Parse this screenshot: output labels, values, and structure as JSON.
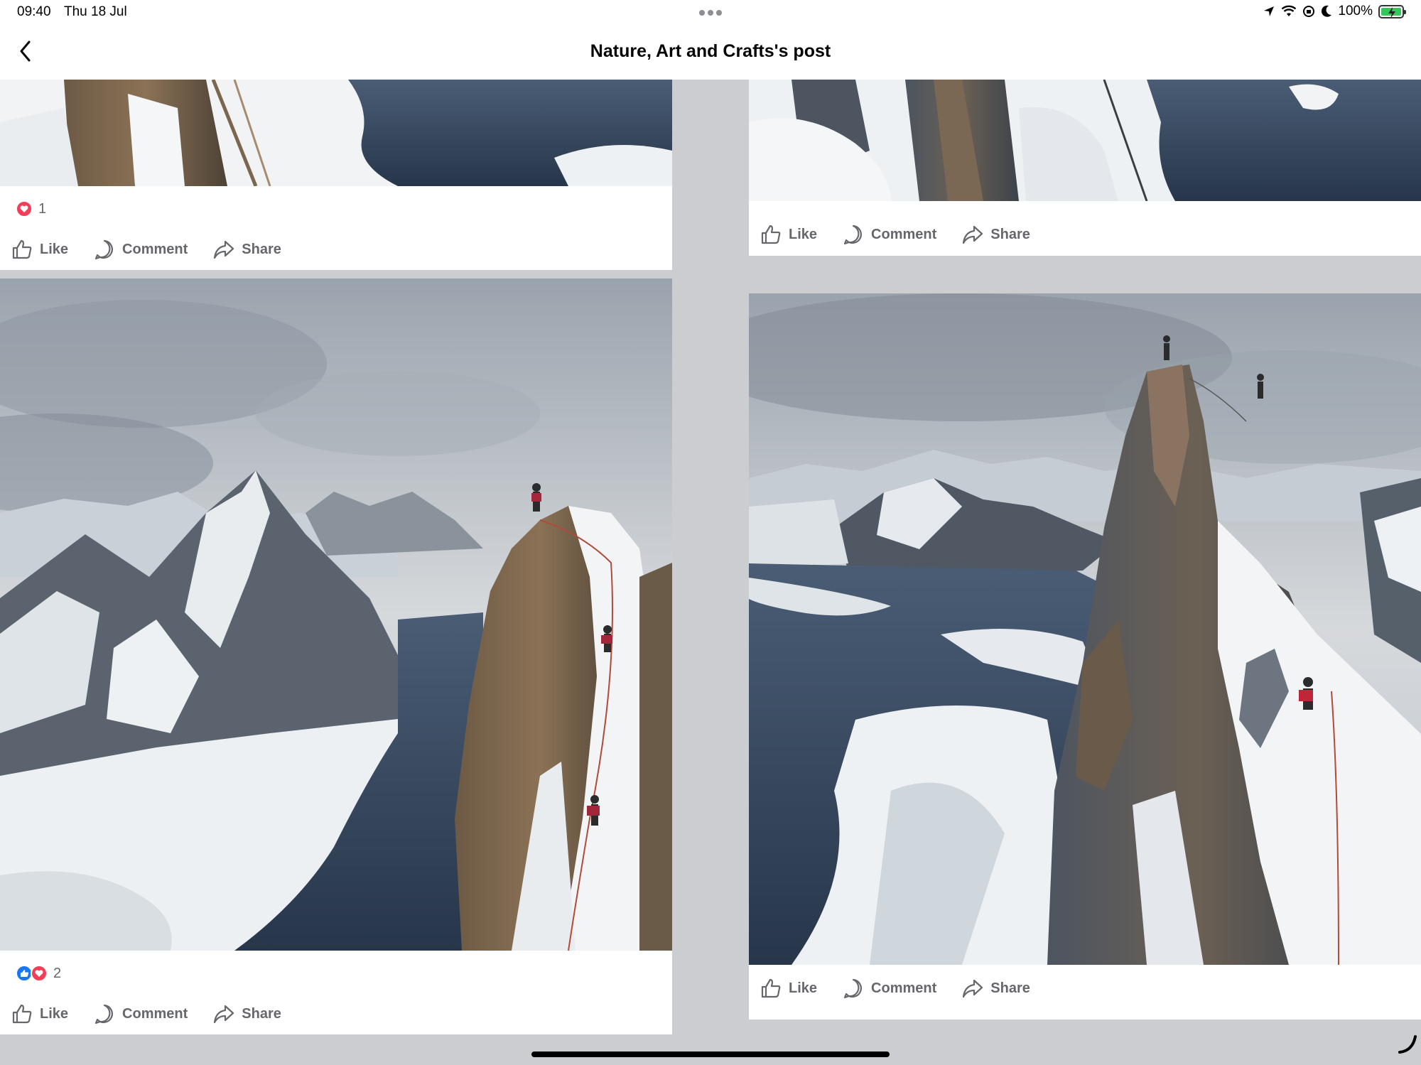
{
  "status_bar": {
    "time": "09:40",
    "date": "Thu 18 Jul",
    "battery": "100%",
    "icons": [
      "location-icon",
      "wifi-icon",
      "lock-rotation-icon",
      "moon-icon",
      "battery-icon"
    ]
  },
  "nav": {
    "title": "Nature, Art and Crafts's post",
    "back_icon": "chevron-left-icon"
  },
  "posts": [
    {
      "column": "left",
      "reaction_count": "1",
      "reaction_types": [
        "love"
      ],
      "actions": [
        "Like",
        "Comment",
        "Share"
      ]
    },
    {
      "column": "left",
      "reaction_count": "2",
      "reaction_types": [
        "like",
        "love"
      ],
      "actions": [
        "Like",
        "Comment",
        "Share"
      ]
    },
    {
      "column": "right",
      "actions": [
        "Like",
        "Comment",
        "Share"
      ]
    },
    {
      "column": "right",
      "actions": [
        "Like",
        "Comment",
        "Share"
      ]
    }
  ],
  "colors": {
    "background": "#cbcdd1",
    "card": "#ffffff",
    "action_text": "#65676b",
    "love": "#f33e58",
    "like": "#1877f2",
    "battery": "#34c759"
  }
}
